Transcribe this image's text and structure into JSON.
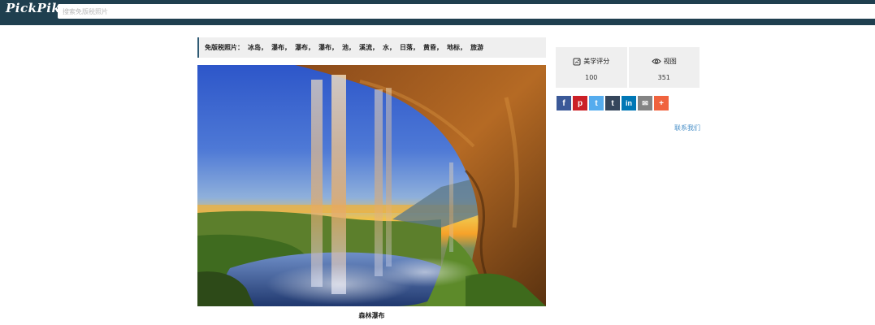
{
  "header": {
    "logo": "PickPik",
    "search_placeholder": "搜索免版税照片",
    "bar_color": "#1f3f4f"
  },
  "tags": {
    "label": "免版税照片：",
    "items": [
      "冰岛",
      "瀑布",
      "瀑布",
      "瀑布",
      "池",
      "溪流",
      "水",
      "日落",
      "黄昏",
      "地标",
      "旅游"
    ],
    "separator": "，",
    "accent_color": "#2f5a74"
  },
  "photo": {
    "caption": "森林瀑布"
  },
  "stats": {
    "rating": {
      "icon": "rating-icon",
      "label": "美学评分",
      "value": "100"
    },
    "views": {
      "icon": "eye-icon",
      "label": "视图",
      "value": "351"
    }
  },
  "share": {
    "buttons": [
      {
        "name": "facebook",
        "icon": "facebook-icon",
        "glyph": "f",
        "color": "#3b5998"
      },
      {
        "name": "pinterest",
        "icon": "pinterest-icon",
        "glyph": "p",
        "color": "#cb2027"
      },
      {
        "name": "twitter",
        "icon": "twitter-icon",
        "glyph": "t",
        "color": "#55acee"
      },
      {
        "name": "tumblr",
        "icon": "tumblr-icon",
        "glyph": "t",
        "color": "#35465c"
      },
      {
        "name": "linkedin",
        "icon": "linkedin-icon",
        "glyph": "in",
        "color": "#0077b5"
      },
      {
        "name": "email",
        "icon": "email-icon",
        "glyph": "✉",
        "color": "#848484"
      },
      {
        "name": "more",
        "icon": "plus-icon",
        "glyph": "+",
        "color": "#f0633e"
      }
    ]
  },
  "contact_link": "联系我们"
}
